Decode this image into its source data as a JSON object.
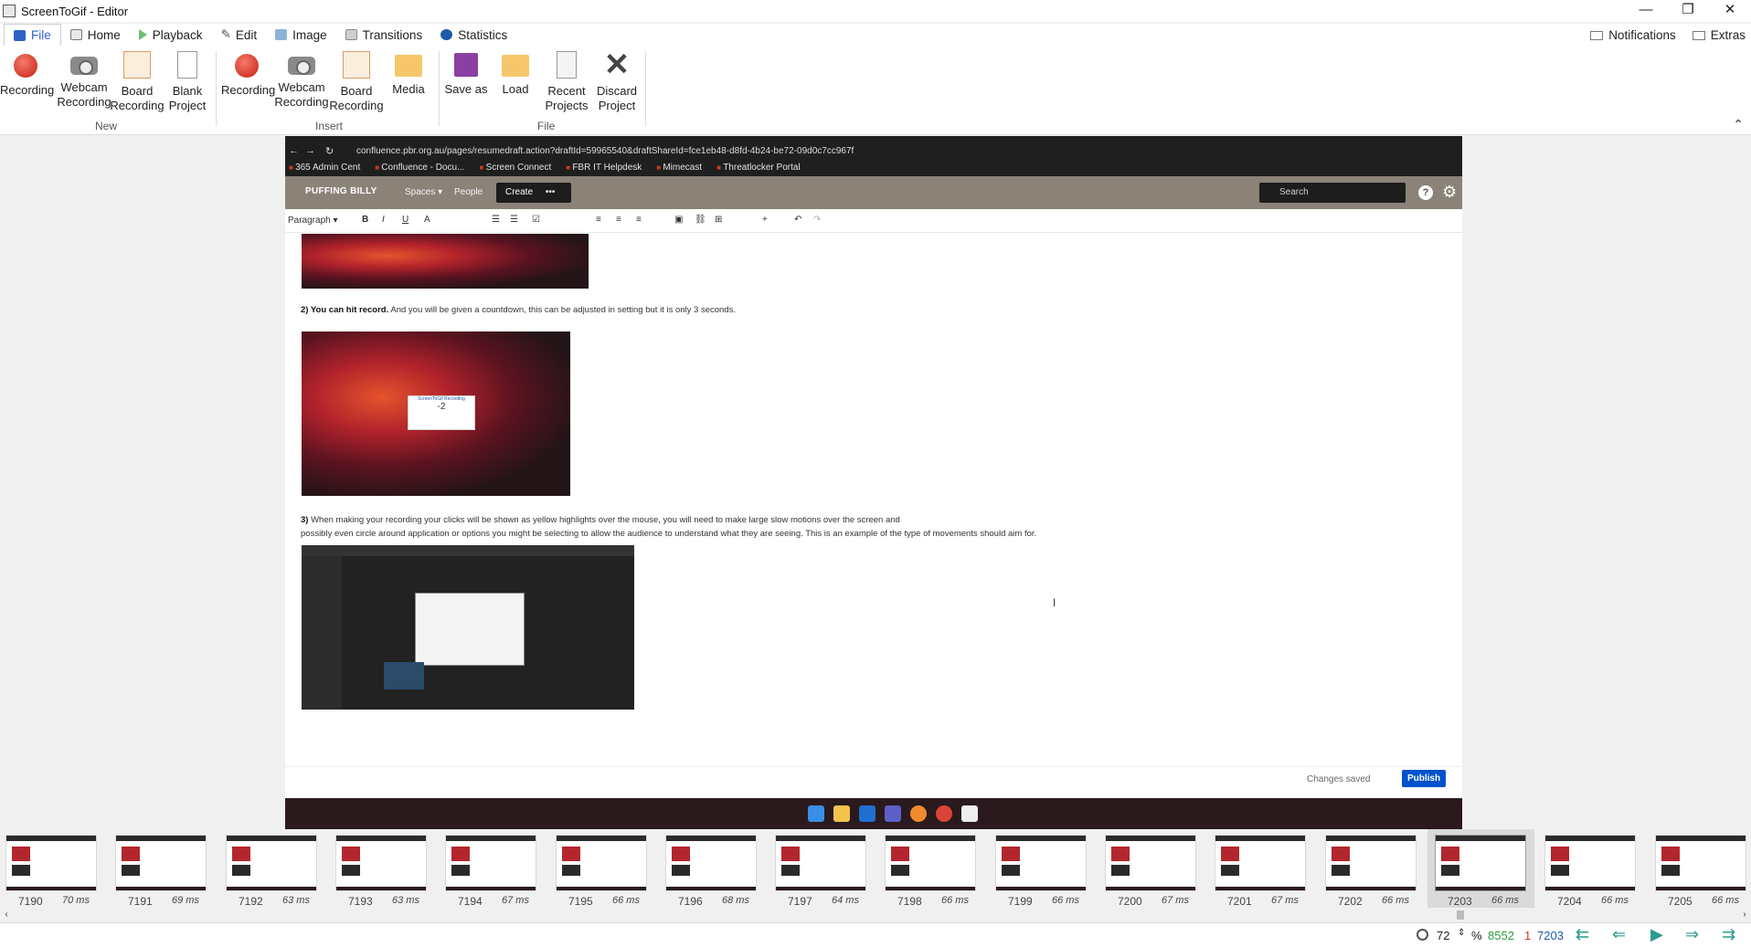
{
  "window": {
    "title": "ScreenToGif - Editor",
    "controls": [
      "—",
      "❐",
      "✕"
    ]
  },
  "tabs": [
    {
      "label": "File",
      "color": "#2f62c5"
    },
    {
      "label": "Home",
      "color": "#6b6b6b"
    },
    {
      "label": "Playback",
      "color": "#4caf50"
    },
    {
      "label": "Edit",
      "color": "#555"
    },
    {
      "label": "Image",
      "color": "#555"
    },
    {
      "label": "Transitions",
      "color": "#555"
    },
    {
      "label": "Statistics",
      "color": "#1e5aa8"
    }
  ],
  "tabs_right": {
    "notifications": "Notifications",
    "extras": "Extras"
  },
  "ribbon": {
    "new": {
      "group_label": "New",
      "recording": "Recording",
      "webcam_line1": "Webcam",
      "webcam_line2": "Recording",
      "board_line1": "Board",
      "board_line2": "Recording",
      "blank_line1": "Blank",
      "blank_line2": "Project"
    },
    "insert": {
      "group_label": "Insert",
      "recording": "Recording",
      "webcam_line1": "Webcam",
      "webcam_line2": "Recording",
      "board_line1": "Board",
      "board_line2": "Recording",
      "media": "Media"
    },
    "file": {
      "group_label": "File",
      "save_as": "Save as",
      "load": "Load",
      "recent_line1": "Recent",
      "recent_line2": "Projects",
      "discard_line1": "Discard",
      "discard_line2": "Project"
    }
  },
  "frame": {
    "address": "confluence.pbr.org.au/pages/resumedraft.action?draftId=59965540&draftShareId=fce1eb48-d8fd-4b24-be72-09d0c7cc967f",
    "bookmarks": [
      "365 Admin Cent",
      "Confluence - Docu...",
      "Screen Connect",
      "FBR IT Helpdesk",
      "Mimecast",
      "Threatlocker Portal"
    ],
    "confluence": {
      "logo": "PUFFING BILLY",
      "spaces": "Spaces ▾",
      "people": "People",
      "create": "Create",
      "more": "•••",
      "search_placeholder": "Search",
      "help": "?"
    },
    "editor": {
      "paragraph": "Paragraph ▾",
      "step2_bold": "2) You can hit record.",
      "step2_text": " And you will be given a countdown, this can be adjusted in setting but it is only 3 seconds.",
      "step3_bold": "3)",
      "step3_line1": " When making your recording your clicks will be shown as yellow highlights over the mouse, you will need to make large slow motions over the screen and",
      "step3_line2": "possibly even circle around application or options you might be selecting to allow the audience to understand what they are seeing. This is an example of the type of movements should aim for.",
      "countdown_title": "ScreenToGif Recording",
      "countdown_value": "-2",
      "changes_saved": "Changes saved",
      "publish": "Publish"
    }
  },
  "frames": [
    {
      "num": "7190",
      "delay": "70 ms"
    },
    {
      "num": "7191",
      "delay": "69 ms"
    },
    {
      "num": "7192",
      "delay": "63 ms"
    },
    {
      "num": "7193",
      "delay": "63 ms"
    },
    {
      "num": "7194",
      "delay": "67 ms"
    },
    {
      "num": "7195",
      "delay": "66 ms"
    },
    {
      "num": "7196",
      "delay": "68 ms"
    },
    {
      "num": "7197",
      "delay": "64 ms"
    },
    {
      "num": "7198",
      "delay": "66 ms"
    },
    {
      "num": "7199",
      "delay": "66 ms"
    },
    {
      "num": "7200",
      "delay": "67 ms"
    },
    {
      "num": "7201",
      "delay": "67 ms"
    },
    {
      "num": "7202",
      "delay": "66 ms"
    },
    {
      "num": "7203",
      "delay": "66 ms",
      "selected": true
    },
    {
      "num": "7204",
      "delay": "66 ms"
    },
    {
      "num": "7205",
      "delay": "66 ms"
    }
  ],
  "statusbar": {
    "zoom": "72",
    "zoom_unit": "%",
    "frame_count": "8552",
    "selected_count": "1",
    "current_frame": "7203",
    "count_color": "#2e9e3f",
    "selected_color": "#d32f2f",
    "current_color": "#1e5aa8"
  }
}
